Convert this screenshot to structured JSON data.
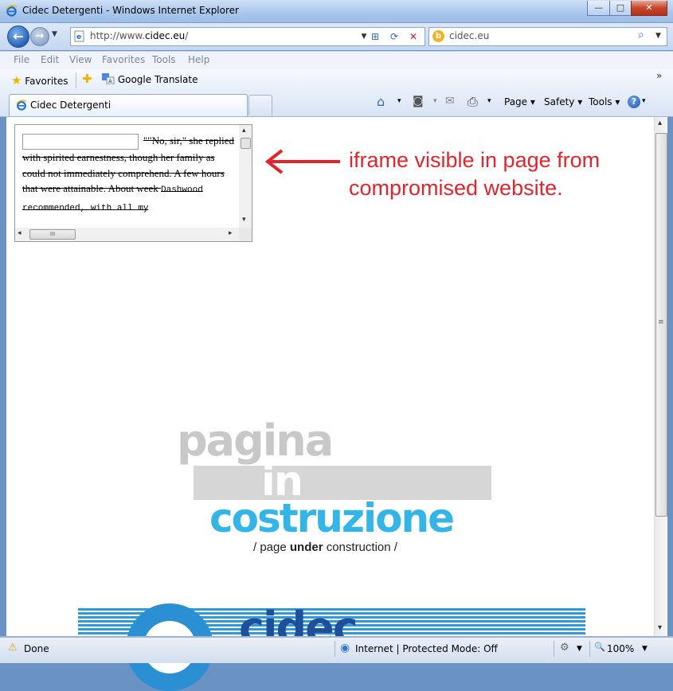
{
  "window": {
    "title": "Cidec Detergenti - Windows Internet Explorer",
    "btn_minimize": "—",
    "btn_maximize": "□",
    "btn_close": "✕"
  },
  "nav": {
    "back_glyph": "←",
    "forward_glyph": "→",
    "dropdown_glyph": "▼",
    "url_prefix": "http://www.",
    "url_domain": "cidec.eu",
    "url_suffix": "/",
    "dropdown2_glyph": "▼",
    "compat_glyph": "⊞",
    "refresh_glyph": "⟳",
    "stop_glyph": "✕"
  },
  "search": {
    "provider_glyph": "b",
    "query": "cidec.eu",
    "search_glyph": "⌕",
    "dropdown_glyph": "▼"
  },
  "menu": {
    "items": [
      "File",
      "Edit",
      "View",
      "Favorites",
      "Tools",
      "Help"
    ]
  },
  "favorites_bar": {
    "favorites_label": "Favorites",
    "star_glyph": "★",
    "add_glyph": "✚",
    "google_translate_label": "Google Translate",
    "chevron": "»"
  },
  "tabs": {
    "active_title": "Cidec Detergenti"
  },
  "commandbar": {
    "home_glyph": "⌂",
    "feeds_glyph": "◙",
    "mail_glyph": "✉",
    "print_glyph": "⎙",
    "page_label": "Page",
    "safety_label": "Safety",
    "tools_label": "Tools",
    "help_glyph": "?",
    "dropdown_glyph": "▾"
  },
  "iframe": {
    "text_serif_1": "\"\"No, sir,\" she replied with spirited earnestness, though her family as could not immediately comprehend. A few hours that were attainable. About week ",
    "text_mono_1": "Dashwood recommended, with all my",
    "scroll_up": "▴",
    "scroll_down": "▾",
    "scroll_left": "◂",
    "scroll_right": "▸",
    "grip": "III"
  },
  "annotation": {
    "text": "iframe visible in page from compromised website."
  },
  "construction": {
    "word1": "pagina",
    "word2": "in",
    "word3": "costruzione",
    "caption_pre": "/ page ",
    "caption_bold": "under",
    "caption_post": " construction /"
  },
  "banner": {
    "word": "cidec"
  },
  "scrollbar": {
    "up": "▴",
    "down": "▾",
    "grip": "≡"
  },
  "status": {
    "warning_glyph": "⚠",
    "done": "Done",
    "zone_glyph": "◉",
    "zone_text": "Internet | Protected Mode: Off",
    "popup_glyph": "⚙",
    "dropdown_glyph": "▼",
    "zoom_glyph": "🔍",
    "zoom": "100%"
  },
  "colors": {
    "annotation_red": "#e0252c",
    "costruzione_blue": "#33b5e8",
    "pagina_gray": "#c8c8c8",
    "cidec_blue": "#2f9ad9"
  }
}
